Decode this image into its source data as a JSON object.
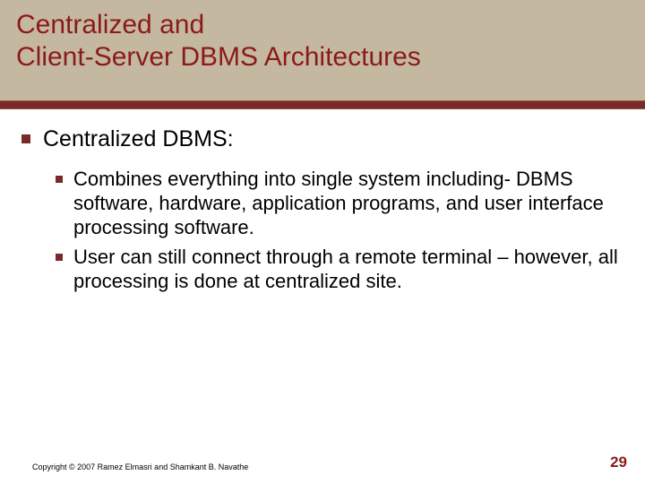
{
  "title": "Centralized and\nClient-Server DBMS Architectures",
  "heading1": "Centralized DBMS:",
  "sub1": "Combines everything into single system including- DBMS software, hardware, application programs, and user interface processing software.",
  "sub2": "User can still connect through a remote terminal – however, all processing is done at centralized site.",
  "copyright": "Copyright © 2007 Ramez Elmasri and Shamkant B. Navathe",
  "page": "29"
}
